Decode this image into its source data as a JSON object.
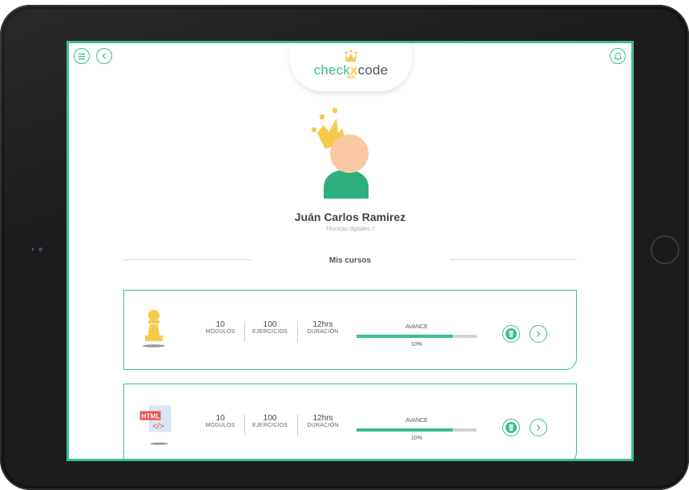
{
  "app": {
    "logo_left": "check",
    "logo_right": "code"
  },
  "profile": {
    "name": "Juán Carlos Ramirez",
    "subtitle": "Técnicas digitales 7"
  },
  "section_title": "Mis cursos",
  "courses": [
    {
      "icon": "chess-pawn-icon",
      "modules_value": "10",
      "modules_label": "MÓDULOS",
      "exercises_value": "100",
      "exercises_label": "EJERCICIOS",
      "duration_value": "12hrs",
      "duration_label": "DURACIÓN",
      "progress_label": "AVANCE",
      "progress_text": "10%",
      "progress_fraction": 0.8
    },
    {
      "icon": "html-code-icon",
      "icon_badge": "HTML",
      "icon_glyph": "</>",
      "modules_value": "10",
      "modules_label": "MÓDULOS",
      "exercises_value": "100",
      "exercises_label": "EJERCICIOS",
      "duration_value": "12hrs",
      "duration_label": "DURACIÓN",
      "progress_label": "AVANCE",
      "progress_text": "10%",
      "progress_fraction": 0.8
    }
  ],
  "colors": {
    "accent": "#3dbd8f",
    "crown": "#f6c94a",
    "skin": "#f9c9a2",
    "badge_red": "#e8554e"
  },
  "icons": [
    "menu-icon",
    "back-icon",
    "bell-icon",
    "crown-icon",
    "trash-icon",
    "chevron-right-icon"
  ]
}
